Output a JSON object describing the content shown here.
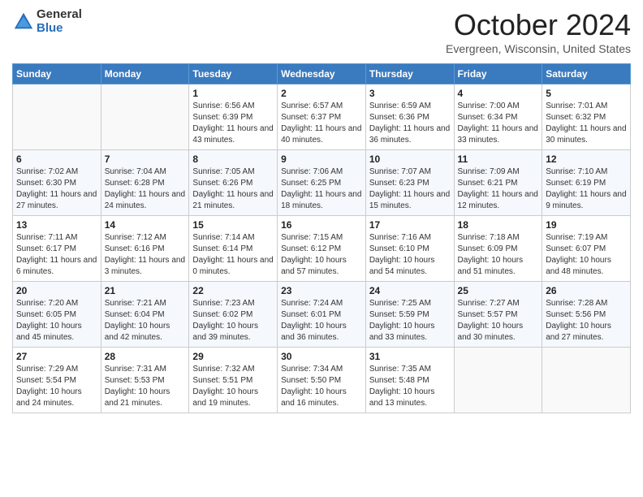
{
  "header": {
    "logo_general": "General",
    "logo_blue": "Blue",
    "title": "October 2024",
    "location": "Evergreen, Wisconsin, United States"
  },
  "days_of_week": [
    "Sunday",
    "Monday",
    "Tuesday",
    "Wednesday",
    "Thursday",
    "Friday",
    "Saturday"
  ],
  "weeks": [
    [
      {
        "day": "",
        "info": ""
      },
      {
        "day": "",
        "info": ""
      },
      {
        "day": "1",
        "info": "Sunrise: 6:56 AM\nSunset: 6:39 PM\nDaylight: 11 hours and 43 minutes."
      },
      {
        "day": "2",
        "info": "Sunrise: 6:57 AM\nSunset: 6:37 PM\nDaylight: 11 hours and 40 minutes."
      },
      {
        "day": "3",
        "info": "Sunrise: 6:59 AM\nSunset: 6:36 PM\nDaylight: 11 hours and 36 minutes."
      },
      {
        "day": "4",
        "info": "Sunrise: 7:00 AM\nSunset: 6:34 PM\nDaylight: 11 hours and 33 minutes."
      },
      {
        "day": "5",
        "info": "Sunrise: 7:01 AM\nSunset: 6:32 PM\nDaylight: 11 hours and 30 minutes."
      }
    ],
    [
      {
        "day": "6",
        "info": "Sunrise: 7:02 AM\nSunset: 6:30 PM\nDaylight: 11 hours and 27 minutes."
      },
      {
        "day": "7",
        "info": "Sunrise: 7:04 AM\nSunset: 6:28 PM\nDaylight: 11 hours and 24 minutes."
      },
      {
        "day": "8",
        "info": "Sunrise: 7:05 AM\nSunset: 6:26 PM\nDaylight: 11 hours and 21 minutes."
      },
      {
        "day": "9",
        "info": "Sunrise: 7:06 AM\nSunset: 6:25 PM\nDaylight: 11 hours and 18 minutes."
      },
      {
        "day": "10",
        "info": "Sunrise: 7:07 AM\nSunset: 6:23 PM\nDaylight: 11 hours and 15 minutes."
      },
      {
        "day": "11",
        "info": "Sunrise: 7:09 AM\nSunset: 6:21 PM\nDaylight: 11 hours and 12 minutes."
      },
      {
        "day": "12",
        "info": "Sunrise: 7:10 AM\nSunset: 6:19 PM\nDaylight: 11 hours and 9 minutes."
      }
    ],
    [
      {
        "day": "13",
        "info": "Sunrise: 7:11 AM\nSunset: 6:17 PM\nDaylight: 11 hours and 6 minutes."
      },
      {
        "day": "14",
        "info": "Sunrise: 7:12 AM\nSunset: 6:16 PM\nDaylight: 11 hours and 3 minutes."
      },
      {
        "day": "15",
        "info": "Sunrise: 7:14 AM\nSunset: 6:14 PM\nDaylight: 11 hours and 0 minutes."
      },
      {
        "day": "16",
        "info": "Sunrise: 7:15 AM\nSunset: 6:12 PM\nDaylight: 10 hours and 57 minutes."
      },
      {
        "day": "17",
        "info": "Sunrise: 7:16 AM\nSunset: 6:10 PM\nDaylight: 10 hours and 54 minutes."
      },
      {
        "day": "18",
        "info": "Sunrise: 7:18 AM\nSunset: 6:09 PM\nDaylight: 10 hours and 51 minutes."
      },
      {
        "day": "19",
        "info": "Sunrise: 7:19 AM\nSunset: 6:07 PM\nDaylight: 10 hours and 48 minutes."
      }
    ],
    [
      {
        "day": "20",
        "info": "Sunrise: 7:20 AM\nSunset: 6:05 PM\nDaylight: 10 hours and 45 minutes."
      },
      {
        "day": "21",
        "info": "Sunrise: 7:21 AM\nSunset: 6:04 PM\nDaylight: 10 hours and 42 minutes."
      },
      {
        "day": "22",
        "info": "Sunrise: 7:23 AM\nSunset: 6:02 PM\nDaylight: 10 hours and 39 minutes."
      },
      {
        "day": "23",
        "info": "Sunrise: 7:24 AM\nSunset: 6:01 PM\nDaylight: 10 hours and 36 minutes."
      },
      {
        "day": "24",
        "info": "Sunrise: 7:25 AM\nSunset: 5:59 PM\nDaylight: 10 hours and 33 minutes."
      },
      {
        "day": "25",
        "info": "Sunrise: 7:27 AM\nSunset: 5:57 PM\nDaylight: 10 hours and 30 minutes."
      },
      {
        "day": "26",
        "info": "Sunrise: 7:28 AM\nSunset: 5:56 PM\nDaylight: 10 hours and 27 minutes."
      }
    ],
    [
      {
        "day": "27",
        "info": "Sunrise: 7:29 AM\nSunset: 5:54 PM\nDaylight: 10 hours and 24 minutes."
      },
      {
        "day": "28",
        "info": "Sunrise: 7:31 AM\nSunset: 5:53 PM\nDaylight: 10 hours and 21 minutes."
      },
      {
        "day": "29",
        "info": "Sunrise: 7:32 AM\nSunset: 5:51 PM\nDaylight: 10 hours and 19 minutes."
      },
      {
        "day": "30",
        "info": "Sunrise: 7:34 AM\nSunset: 5:50 PM\nDaylight: 10 hours and 16 minutes."
      },
      {
        "day": "31",
        "info": "Sunrise: 7:35 AM\nSunset: 5:48 PM\nDaylight: 10 hours and 13 minutes."
      },
      {
        "day": "",
        "info": ""
      },
      {
        "day": "",
        "info": ""
      }
    ]
  ]
}
